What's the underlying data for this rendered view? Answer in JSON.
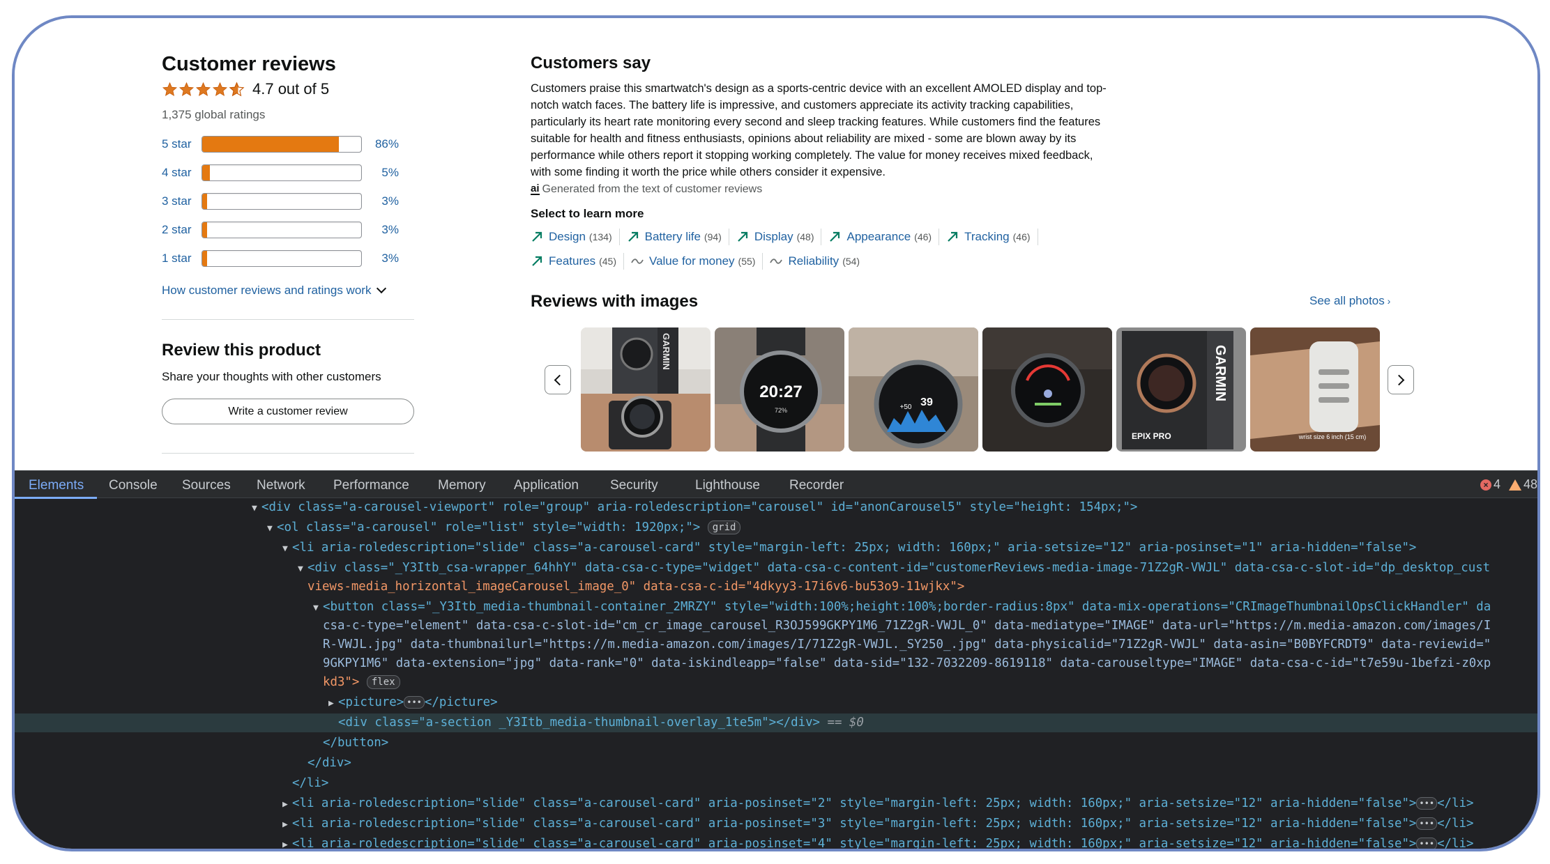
{
  "reviews": {
    "title": "Customer reviews",
    "rating_value": 4.7,
    "rating_text": "4.7 out of 5",
    "global_ratings": "1,375 global ratings",
    "histogram": [
      {
        "label": "5 star",
        "pct": "86%",
        "value": 86
      },
      {
        "label": "4 star",
        "pct": "5%",
        "value": 5
      },
      {
        "label": "3 star",
        "pct": "3%",
        "value": 3
      },
      {
        "label": "2 star",
        "pct": "3%",
        "value": 3
      },
      {
        "label": "1 star",
        "pct": "3%",
        "value": 3
      }
    ],
    "how_link": "How customer reviews and ratings work",
    "review_title": "Review this product",
    "review_sub": "Share your thoughts with other customers",
    "write_button": "Write a customer review"
  },
  "customers_say": {
    "title": "Customers say",
    "body": "Customers praise this smartwatch's design as a sports-centric device with an excellent AMOLED display and top-notch watch faces. The battery life is impressive, and customers appreciate its activity tracking capabilities, particularly its heart rate monitoring every second and sleep tracking features. While customers find the features suitable for health and fitness enthusiasts, opinions about reliability are mixed - some are blown away by its performance while others report it stopping working completely. The value for money receives mixed feedback, with some finding it worth the price while others consider it expensive.",
    "ai_icon_text": "ai",
    "ai_note": "Generated from the text of customer reviews",
    "select_label": "Select to learn more",
    "aspects_row1": [
      {
        "name": "Design",
        "count": "(134)",
        "trend": "up"
      },
      {
        "name": "Battery life",
        "count": "(94)",
        "trend": "up"
      },
      {
        "name": "Display",
        "count": "(48)",
        "trend": "up"
      },
      {
        "name": "Appearance",
        "count": "(46)",
        "trend": "up"
      },
      {
        "name": "Tracking",
        "count": "(46)",
        "trend": "up"
      }
    ],
    "aspects_row2": [
      {
        "name": "Features",
        "count": "(45)",
        "trend": "up"
      },
      {
        "name": "Value for money",
        "count": "(55)",
        "trend": "mixed"
      },
      {
        "name": "Reliability",
        "count": "(54)",
        "trend": "mixed"
      }
    ]
  },
  "images": {
    "title": "Reviews with images",
    "see_all": "See all photos",
    "thumbs": [
      {
        "brand": "GARMIN",
        "time": "",
        "caption": ""
      },
      {
        "brand": "",
        "time": "20:27",
        "caption": "72%"
      },
      {
        "brand": "",
        "time": "39",
        "caption": "+50"
      },
      {
        "brand": "",
        "time": "",
        "caption": ""
      },
      {
        "brand": "GARMIN",
        "time": "",
        "caption": "EPIX PRO"
      },
      {
        "brand": "",
        "time": "",
        "caption": "wrist size 6 inch (15 cm)"
      }
    ]
  },
  "devtools": {
    "tabs": [
      "Elements",
      "Console",
      "Sources",
      "Network",
      "Performance",
      "Memory",
      "Application",
      "Security",
      "Lighthouse",
      "Recorder"
    ],
    "errors": "4",
    "warnings": "48",
    "badge_grid": "grid",
    "badge_flex": "flex",
    "dollar_ref": "== $0",
    "lines": {
      "l1": "<div class=\"a-carousel-viewport\" role=\"group\" aria-roledescription=\"carousel\" id=\"anonCarousel5\" style=\"height: 154px;\">",
      "l2": "<ol class=\"a-carousel\" role=\"list\" style=\"width: 1920px;\">",
      "l3": "<li aria-roledescription=\"slide\" class=\"a-carousel-card\" style=\"margin-left: 25px; width: 160px;\" aria-setsize=\"12\" aria-posinset=\"1\" aria-hidden=\"false\">",
      "l4": "<div class=\"_Y3Itb_csa-wrapper_64hhY\" data-csa-c-type=\"widget\" data-csa-c-content-id=\"customerReviews-media-image-71Z2gR-VWJL\" data-csa-c-slot-id=\"dp_desktop_cust",
      "l5": "views-media_horizontal_imageCarousel_image_0\" data-csa-c-id=\"4dkyy3-17i6v6-bu53o9-11wjkx\">",
      "l6": "<button class=\"_Y3Itb_media-thumbnail-container_2MRZY\" style=\"width:100%;height:100%;border-radius:8px\" data-mix-operations=\"CRImageThumbnailOpsClickHandler\" da",
      "l7": "csa-c-type=\"element\" data-csa-c-slot-id=\"cm_cr_image_carousel_R3OJ599GKPY1M6_71Z2gR-VWJL_0\" data-mediatype=\"IMAGE\" data-url=\"https://m.media-amazon.com/images/I",
      "l8": "R-VWJL.jpg\" data-thumbnailurl=\"https://m.media-amazon.com/images/I/71Z2gR-VWJL._SY250_.jpg\" data-physicalid=\"71Z2gR-VWJL\" data-asin=\"B0BYFCRDT9\" data-reviewid=\"",
      "l9": "9GKPY1M6\" data-extension=\"jpg\" data-rank=\"0\" data-iskindleapp=\"false\" data-sid=\"132-7032209-8619118\" data-carouseltype=\"IMAGE\" data-csa-c-id=\"t7e59u-1befzi-z0xp",
      "l10": "kd3\">",
      "l11": "<picture>",
      "l11b": "</picture>",
      "l12": "<div class=\"a-section _Y3Itb_media-thumbnail-overlay_1te5m\"></div>",
      "l13": "</button>",
      "l14": "</div>",
      "l15": "</li>",
      "l16": "<li aria-roledescription=\"slide\" class=\"a-carousel-card\" aria-posinset=\"2\" style=\"margin-left: 25px; width: 160px;\" aria-setsize=\"12\" aria-hidden=\"false\">",
      "l17": "<li aria-roledescription=\"slide\" class=\"a-carousel-card\" aria-posinset=\"3\" style=\"margin-left: 25px; width: 160px;\" aria-setsize=\"12\" aria-hidden=\"false\">",
      "l18": "<li aria-roledescription=\"slide\" class=\"a-carousel-card\" aria-posinset=\"4\" style=\"margin-left: 25px; width: 160px;\" aria-setsize=\"12\" aria-hidden=\"false\">",
      "li_close": "</li>"
    }
  },
  "colors": {
    "accent_orange": "#e47911",
    "link_blue": "#2162a1",
    "devtools_bg": "#202124",
    "devtools_tab_active": "#7cacf8"
  }
}
